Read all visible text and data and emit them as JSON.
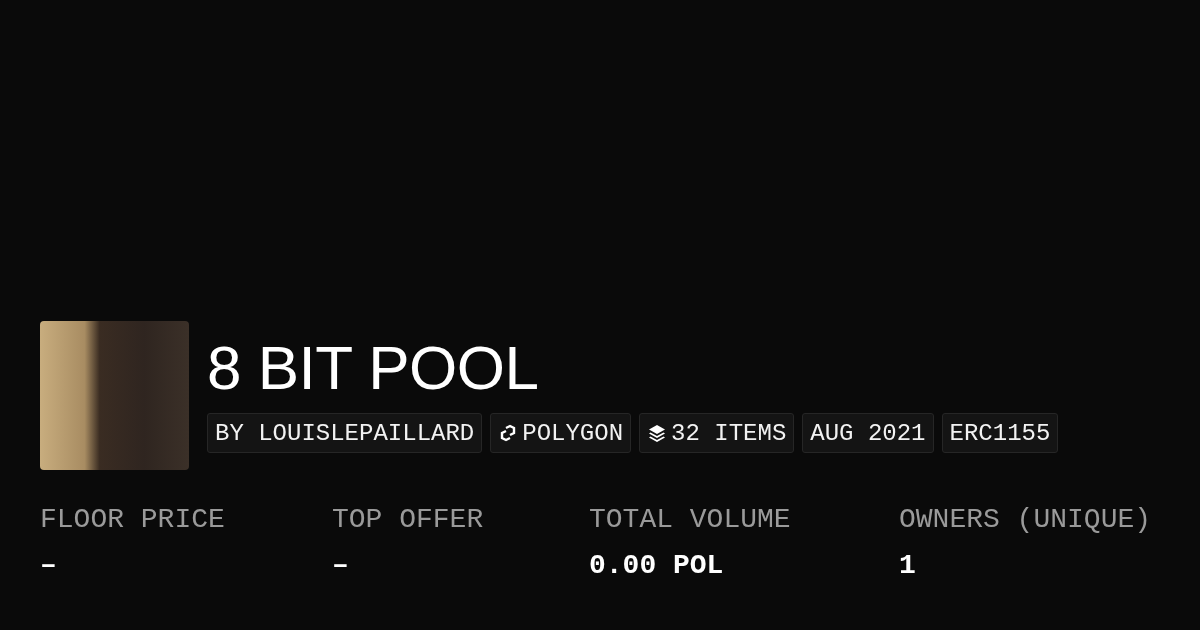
{
  "collection": {
    "title": "8 BIT POOL",
    "tags": [
      {
        "kind": "creator",
        "label": "BY LOUISLEPAILLARD"
      },
      {
        "kind": "chain",
        "label": "POLYGON"
      },
      {
        "kind": "items",
        "label": "32 ITEMS"
      },
      {
        "kind": "date",
        "label": "AUG 2021"
      },
      {
        "kind": "standard",
        "label": "ERC1155"
      }
    ]
  },
  "stats": [
    {
      "label": "FLOOR PRICE",
      "value": "–"
    },
    {
      "label": "TOP OFFER",
      "value": "–"
    },
    {
      "label": "TOTAL VOLUME",
      "value": "0.00 POL"
    },
    {
      "label": "OWNERS (UNIQUE)",
      "value": "1"
    }
  ]
}
